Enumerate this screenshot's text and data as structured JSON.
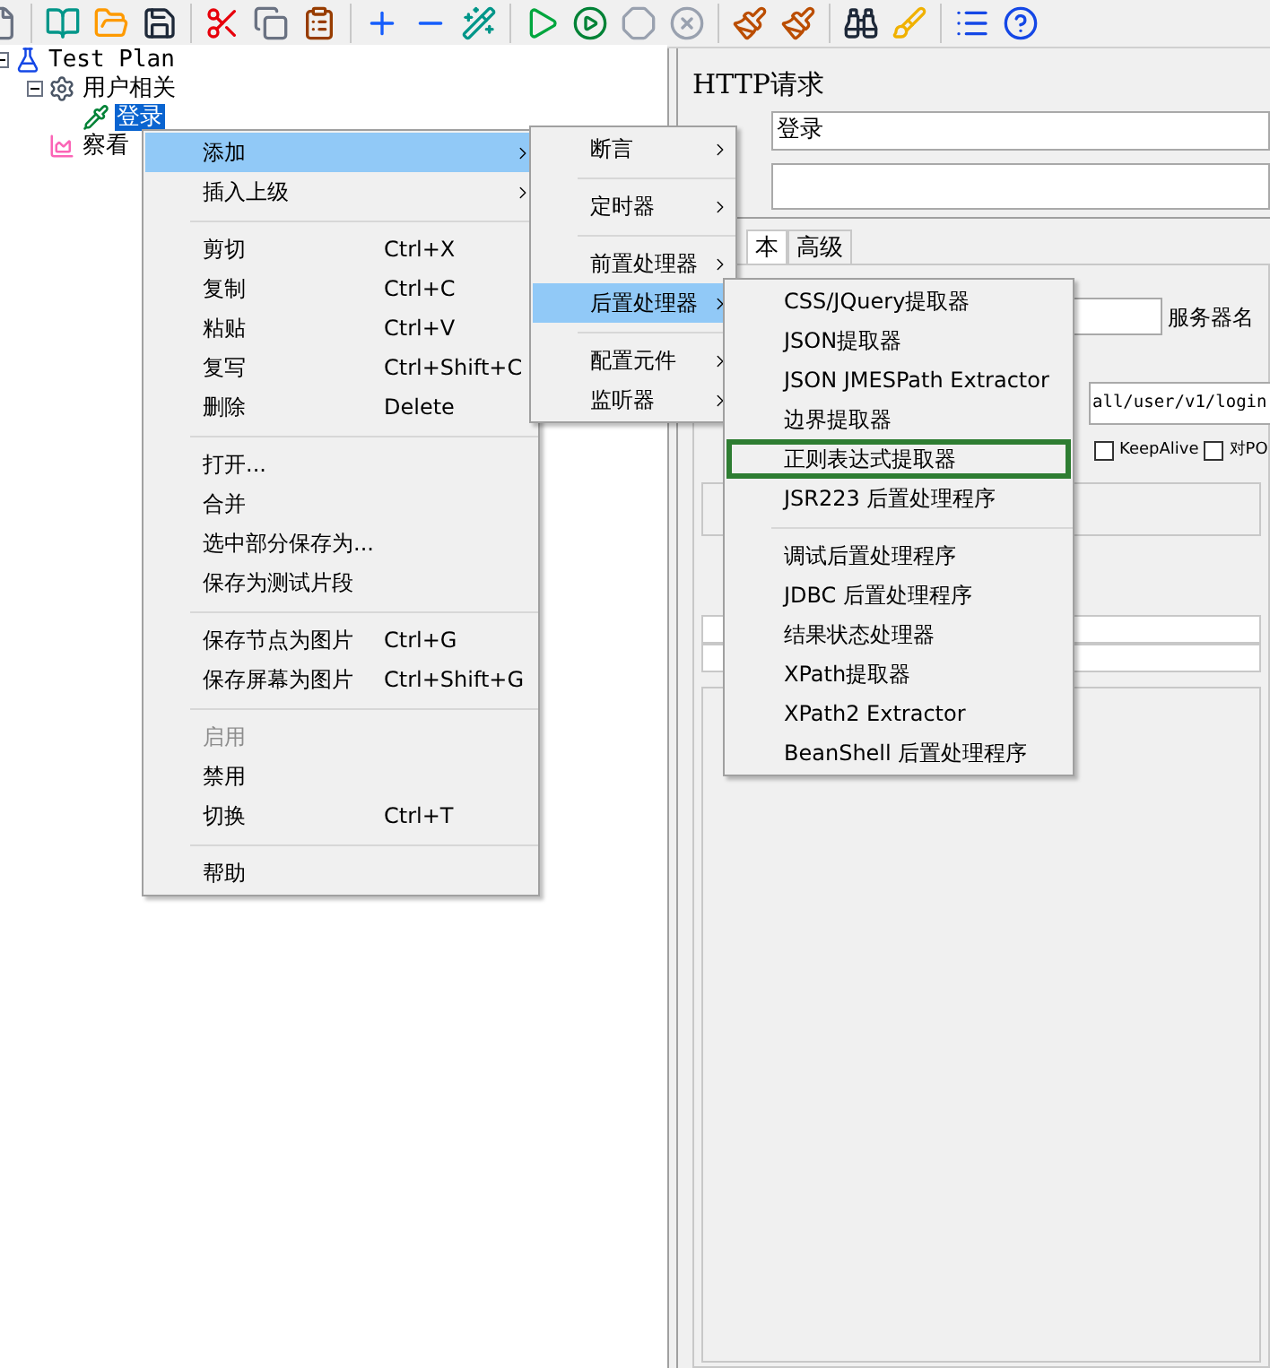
{
  "tree": [
    {
      "label": "Test Plan",
      "kind": "plan",
      "expanded": true,
      "selected": false,
      "children": [
        {
          "label": "用户相关",
          "kind": "group",
          "expanded": true,
          "selected": false,
          "children": [
            {
              "label": "登录",
              "kind": "sampler",
              "selected": true
            }
          ]
        },
        {
          "label": "察看",
          "kind": "listener",
          "selected": false
        }
      ]
    }
  ],
  "editor": {
    "title": "HTTP请求",
    "name_value": "登录",
    "tabs": [
      {
        "label": "本",
        "selected": true
      },
      {
        "label": "高级",
        "selected": false
      }
    ],
    "server_label": "服务器名",
    "path_value": "all/user/v1/login",
    "checkboxes": [
      {
        "label": "KeepAlive",
        "checked": false
      },
      {
        "label": "对PO",
        "checked": false
      }
    ]
  },
  "context_menu": [
    {
      "kind": "item",
      "label": "添加",
      "submenu": true,
      "selected": true,
      "disabled": false
    },
    {
      "kind": "item",
      "label": "插入上级",
      "submenu": true,
      "selected": false,
      "disabled": false
    },
    {
      "kind": "separator"
    },
    {
      "kind": "item",
      "label": "剪切",
      "shortcut": "Ctrl+X",
      "submenu": false,
      "selected": false,
      "disabled": false
    },
    {
      "kind": "item",
      "label": "复制",
      "shortcut": "Ctrl+C",
      "submenu": false,
      "selected": false,
      "disabled": false
    },
    {
      "kind": "item",
      "label": "粘贴",
      "shortcut": "Ctrl+V",
      "submenu": false,
      "selected": false,
      "disabled": false
    },
    {
      "kind": "item",
      "label": "复写",
      "shortcut": "Ctrl+Shift+C",
      "submenu": false,
      "selected": false,
      "disabled": false
    },
    {
      "kind": "item",
      "label": "删除",
      "shortcut": "Delete",
      "submenu": false,
      "selected": false,
      "disabled": false
    },
    {
      "kind": "separator"
    },
    {
      "kind": "item",
      "label": "打开...",
      "submenu": false,
      "selected": false,
      "disabled": false
    },
    {
      "kind": "item",
      "label": "合并",
      "submenu": false,
      "selected": false,
      "disabled": false
    },
    {
      "kind": "item",
      "label": "选中部分保存为...",
      "submenu": false,
      "selected": false,
      "disabled": false
    },
    {
      "kind": "item",
      "label": "保存为测试片段",
      "submenu": false,
      "selected": false,
      "disabled": false
    },
    {
      "kind": "separator"
    },
    {
      "kind": "item",
      "label": "保存节点为图片",
      "shortcut": "Ctrl+G",
      "submenu": false,
      "selected": false,
      "disabled": false
    },
    {
      "kind": "item",
      "label": "保存屏幕为图片",
      "shortcut": "Ctrl+Shift+G",
      "submenu": false,
      "selected": false,
      "disabled": false
    },
    {
      "kind": "separator"
    },
    {
      "kind": "item",
      "label": "启用",
      "submenu": false,
      "selected": false,
      "disabled": true
    },
    {
      "kind": "item",
      "label": "禁用",
      "submenu": false,
      "selected": false,
      "disabled": false
    },
    {
      "kind": "item",
      "label": "切换",
      "shortcut": "Ctrl+T",
      "submenu": false,
      "selected": false,
      "disabled": false
    },
    {
      "kind": "separator"
    },
    {
      "kind": "item",
      "label": "帮助",
      "submenu": false,
      "selected": false,
      "disabled": false
    }
  ],
  "add_submenu": [
    {
      "kind": "item",
      "label": "断言",
      "submenu": true,
      "selected": false
    },
    {
      "kind": "separator"
    },
    {
      "kind": "item",
      "label": "定时器",
      "submenu": true,
      "selected": false
    },
    {
      "kind": "separator"
    },
    {
      "kind": "item",
      "label": "前置处理器",
      "submenu": true,
      "selected": false
    },
    {
      "kind": "item",
      "label": "后置处理器",
      "submenu": true,
      "selected": true
    },
    {
      "kind": "separator"
    },
    {
      "kind": "item",
      "label": "配置元件",
      "submenu": true,
      "selected": false
    },
    {
      "kind": "item",
      "label": "监听器",
      "submenu": true,
      "selected": false
    }
  ],
  "post_processor_submenu": [
    {
      "kind": "item",
      "label": "CSS/JQuery提取器",
      "outlined": false
    },
    {
      "kind": "item",
      "label": "JSON提取器",
      "outlined": false
    },
    {
      "kind": "item",
      "label": "JSON JMESPath Extractor",
      "outlined": false
    },
    {
      "kind": "item",
      "label": "边界提取器",
      "outlined": false
    },
    {
      "kind": "item",
      "label": "正则表达式提取器",
      "outlined": true
    },
    {
      "kind": "item",
      "label": "JSR223 后置处理程序",
      "outlined": false
    },
    {
      "kind": "separator"
    },
    {
      "kind": "item",
      "label": "调试后置处理程序",
      "outlined": false
    },
    {
      "kind": "item",
      "label": "JDBC 后置处理程序",
      "outlined": false
    },
    {
      "kind": "item",
      "label": "结果状态处理器",
      "outlined": false
    },
    {
      "kind": "item",
      "label": "XPath提取器",
      "outlined": false
    },
    {
      "kind": "item",
      "label": "XPath2 Extractor",
      "outlined": false
    },
    {
      "kind": "item",
      "label": "BeanShell 后置处理程序",
      "outlined": false
    }
  ]
}
